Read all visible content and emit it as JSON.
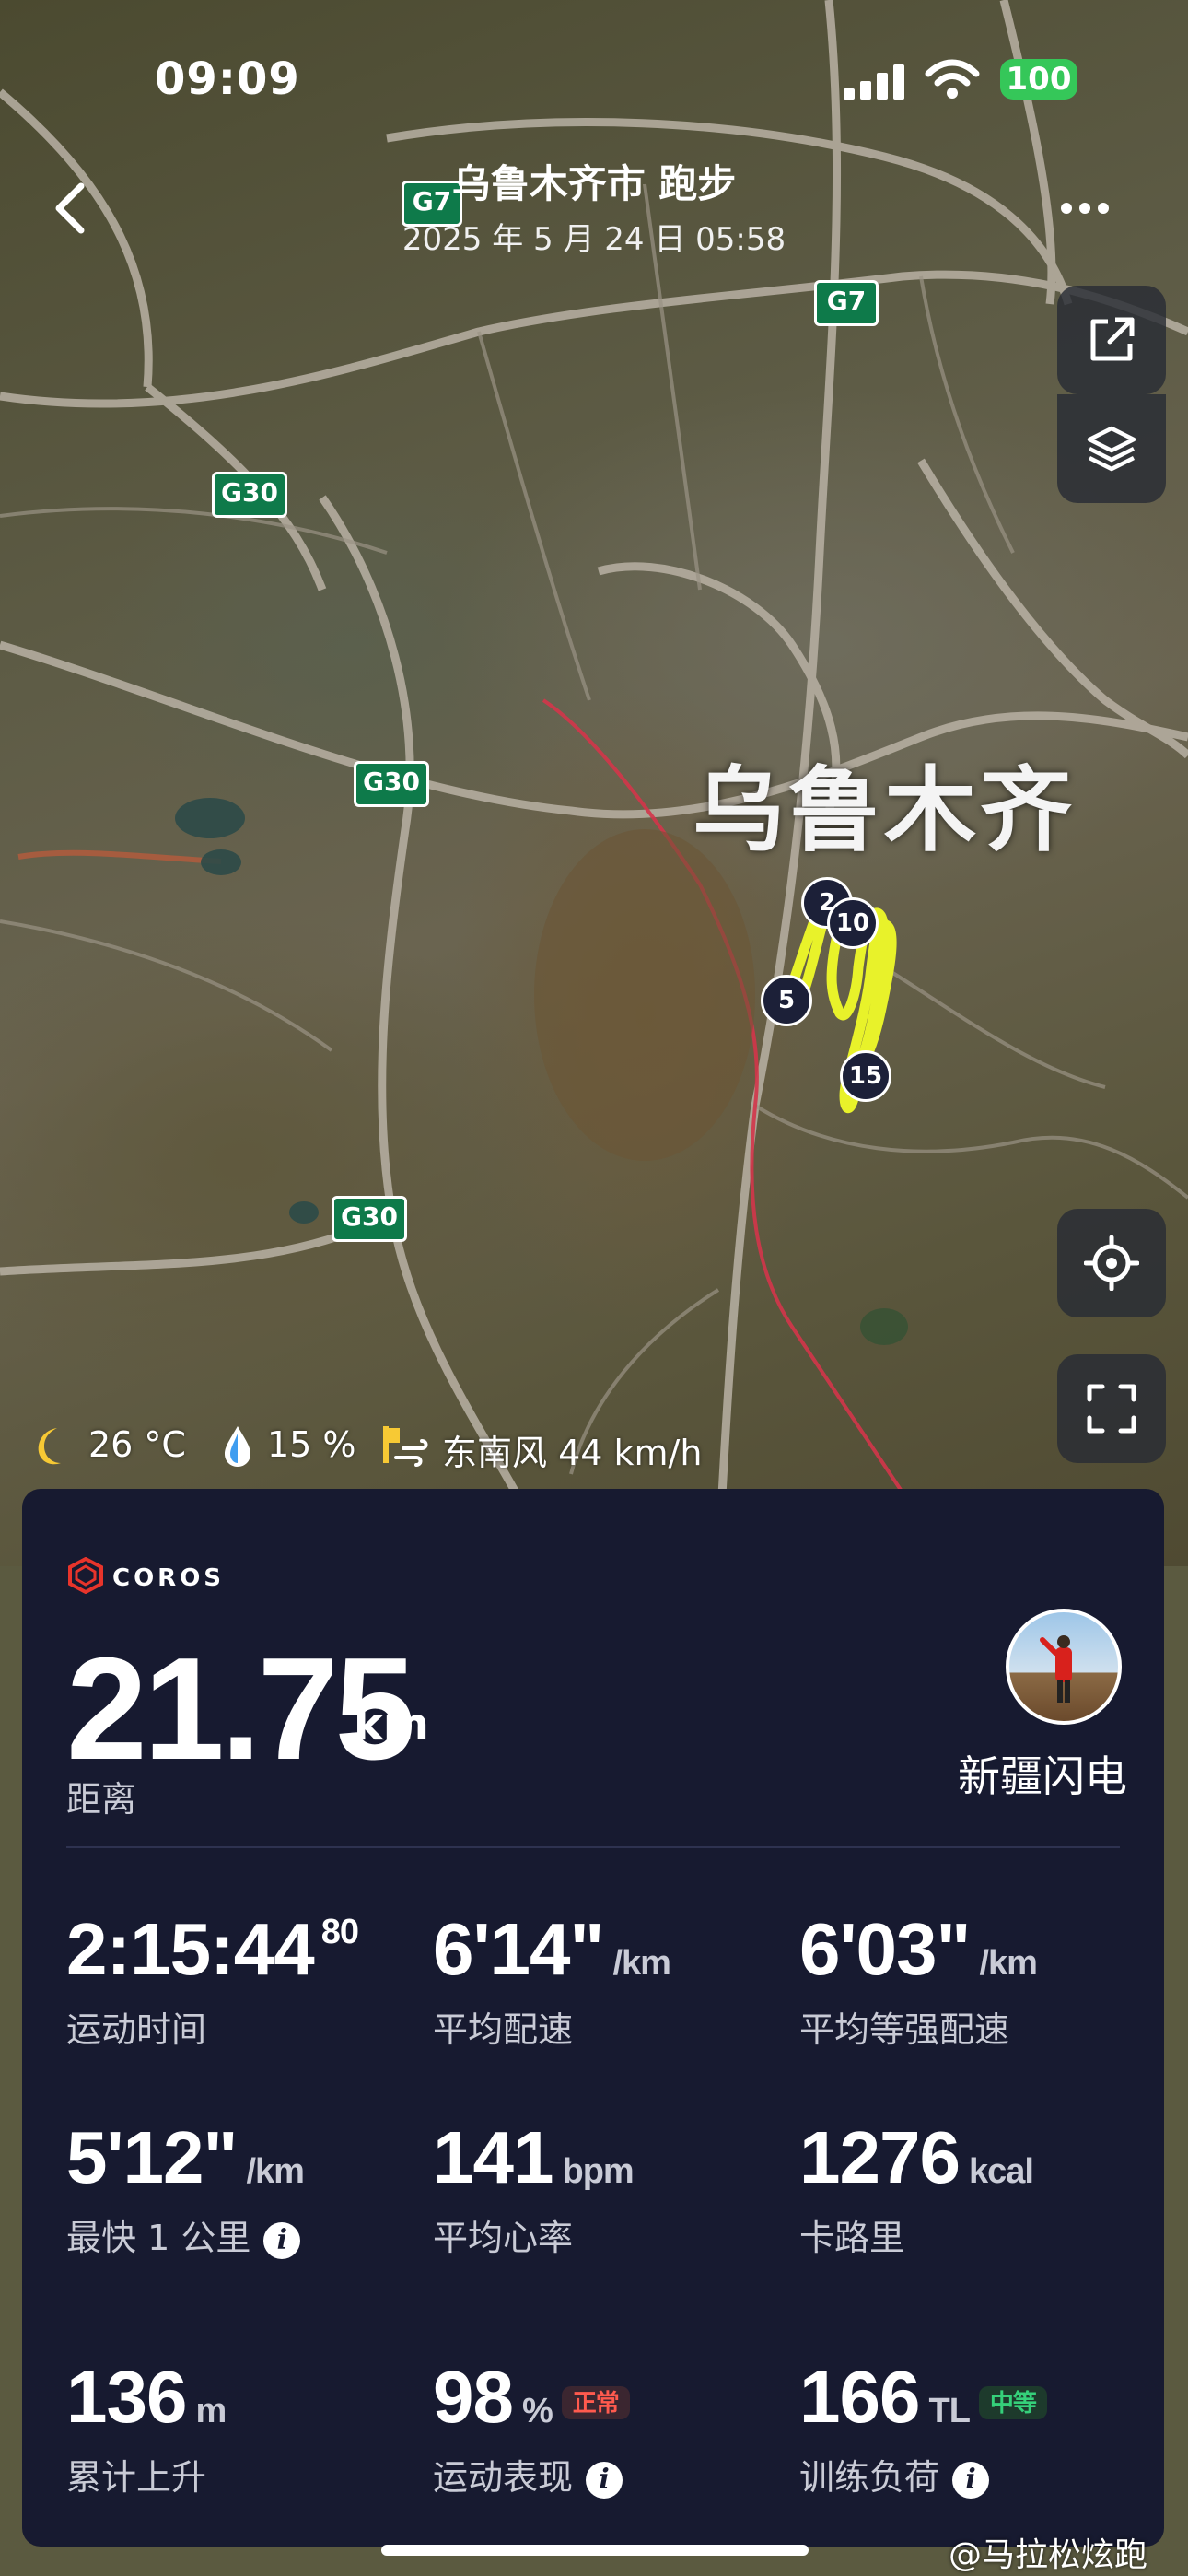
{
  "status": {
    "time": "09:09",
    "battery": "100"
  },
  "nav": {
    "title": "乌鲁木齐市 跑步",
    "subtitle": "2025 年 5 月 24 日 05:58"
  },
  "map": {
    "city": "乌鲁木齐",
    "highways": [
      "G7",
      "G7",
      "G30",
      "G30",
      "G30"
    ],
    "km_markers": [
      "2",
      "5",
      "10",
      "15"
    ],
    "route_color": "#e8f22a",
    "start_color": "#22d13a"
  },
  "map_controls": {
    "share": "share-icon",
    "layers": "layers-icon",
    "locate": "locate-icon",
    "fullscreen": "fullscreen-icon"
  },
  "weather": {
    "temperature": "26 °C",
    "humidity": "15 %",
    "wind": "东南风 44 km/h"
  },
  "summary": {
    "brand": "COROS",
    "distance": "21.75",
    "distance_unit": "km",
    "distance_label": "距离",
    "user_name": "新疆闪电"
  },
  "stats": [
    {
      "value": "2:15:44",
      "sup": "80",
      "unit": "",
      "label": "运动时间"
    },
    {
      "value": "6'14\"",
      "unit": "/km",
      "label": "平均配速"
    },
    {
      "value": "6'03\"",
      "unit": "/km",
      "label": "平均等强配速"
    },
    {
      "value": "5'12\"",
      "unit": "/km",
      "label": "最快 1 公里",
      "info": "i"
    },
    {
      "value": "141",
      "unit": "bpm",
      "label": "平均心率"
    },
    {
      "value": "1276",
      "unit": "kcal",
      "label": "卡路里"
    },
    {
      "value": "136",
      "unit": "m",
      "label": "累计上升"
    },
    {
      "value": "98",
      "unit": "%",
      "tag": "正常",
      "label": "运动表现",
      "info": "i"
    },
    {
      "value": "166",
      "unit": "TL",
      "tag": "中等",
      "label": "训练负荷",
      "info": "i"
    }
  ],
  "watermark": "@马拉松炫跑"
}
